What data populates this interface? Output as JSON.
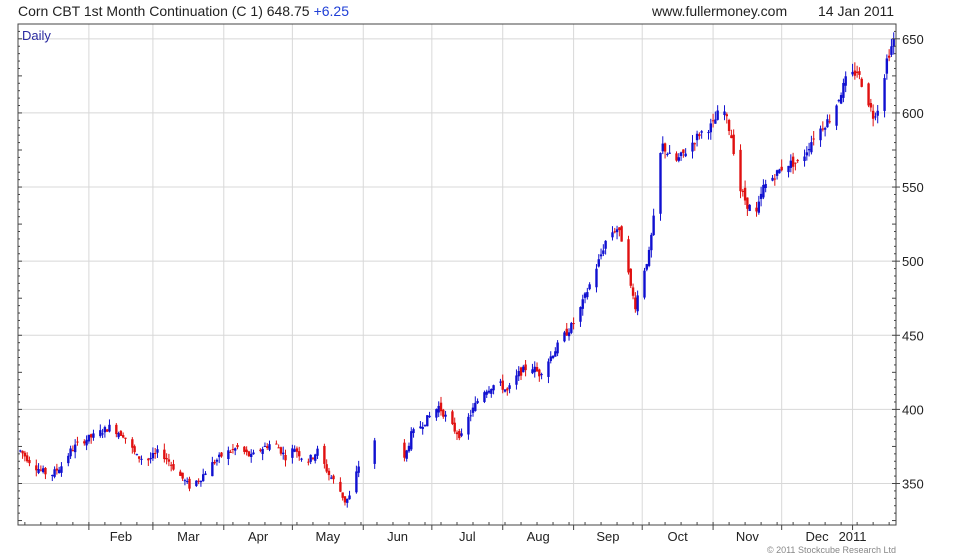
{
  "header": {
    "title": "Corn CBT 1st Month Continuation (C 1) 648.75",
    "change": "+6.25",
    "site": "www.fullermoney.com",
    "date": "14 Jan 2011"
  },
  "copyright": "© 2011 Stockcube Research Ltd",
  "colors": {
    "up": "#1010d0",
    "down": "#e01010",
    "grid": "#d8d8d8",
    "frame": "#444444",
    "label": "#2a2aa0"
  },
  "chart_data": {
    "type": "ohlc",
    "period_label": "Daily",
    "ylim": [
      322,
      660
    ],
    "yticks": [
      350,
      400,
      450,
      500,
      550,
      600,
      650
    ],
    "months": [
      {
        "label": "Feb",
        "day": 31
      },
      {
        "label": "Mar",
        "day": 59
      },
      {
        "label": "Apr",
        "day": 90
      },
      {
        "label": "May",
        "day": 120
      },
      {
        "label": "Jun",
        "day": 151
      },
      {
        "label": "Jul",
        "day": 181
      },
      {
        "label": "Aug",
        "day": 212
      },
      {
        "label": "Sep",
        "day": 243
      },
      {
        "label": "Oct",
        "day": 273
      },
      {
        "label": "Nov",
        "day": 304
      },
      {
        "label": "Dec",
        "day": 334
      },
      {
        "label": "2011",
        "day": 365
      }
    ],
    "price_path": [
      [
        1,
        372
      ],
      [
        7,
        362
      ],
      [
        14,
        355
      ],
      [
        19,
        362
      ],
      [
        23,
        372
      ],
      [
        27,
        378
      ],
      [
        33,
        382
      ],
      [
        40,
        388
      ],
      [
        46,
        383
      ],
      [
        52,
        368
      ],
      [
        57,
        366
      ],
      [
        62,
        372
      ],
      [
        66,
        365
      ],
      [
        71,
        355
      ],
      [
        75,
        348
      ],
      [
        80,
        354
      ],
      [
        84,
        362
      ],
      [
        90,
        370
      ],
      [
        96,
        374
      ],
      [
        102,
        368
      ],
      [
        107,
        374
      ],
      [
        112,
        378
      ],
      [
        117,
        368
      ],
      [
        121,
        374
      ],
      [
        126,
        364
      ],
      [
        131,
        372
      ],
      [
        136,
        356
      ],
      [
        140,
        348
      ],
      [
        143,
        338
      ],
      [
        145,
        341
      ],
      [
        149,
        362
      ],
      [
        153,
        372
      ],
      [
        157,
        382
      ],
      [
        161,
        374
      ],
      [
        165,
        362
      ],
      [
        167,
        348
      ],
      [
        169,
        366
      ],
      [
        172,
        383
      ],
      [
        178,
        392
      ],
      [
        184,
        402
      ],
      [
        191,
        386
      ],
      [
        195,
        380
      ],
      [
        197,
        394
      ],
      [
        203,
        412
      ],
      [
        210,
        418
      ],
      [
        214,
        412
      ],
      [
        219,
        424
      ],
      [
        224,
        430
      ],
      [
        228,
        424
      ],
      [
        234,
        438
      ],
      [
        239,
        450
      ],
      [
        244,
        460
      ],
      [
        249,
        480
      ],
      [
        254,
        500
      ],
      [
        258,
        518
      ],
      [
        262,
        522
      ],
      [
        266,
        508
      ],
      [
        268,
        482
      ],
      [
        270,
        470
      ],
      [
        273,
        490
      ],
      [
        276,
        505
      ],
      [
        278,
        528
      ],
      [
        279,
        560
      ],
      [
        282,
        578
      ],
      [
        287,
        566
      ],
      [
        292,
        574
      ],
      [
        298,
        586
      ],
      [
        304,
        592
      ],
      [
        308,
        606
      ],
      [
        312,
        584
      ],
      [
        316,
        548
      ],
      [
        319,
        538
      ],
      [
        323,
        532
      ],
      [
        326,
        550
      ],
      [
        331,
        558
      ],
      [
        336,
        566
      ],
      [
        342,
        566
      ],
      [
        348,
        584
      ],
      [
        356,
        598
      ],
      [
        362,
        622
      ],
      [
        367,
        628
      ],
      [
        371,
        612
      ],
      [
        374,
        598
      ],
      [
        377,
        606
      ],
      [
        380,
        636
      ],
      [
        383,
        649
      ]
    ]
  }
}
